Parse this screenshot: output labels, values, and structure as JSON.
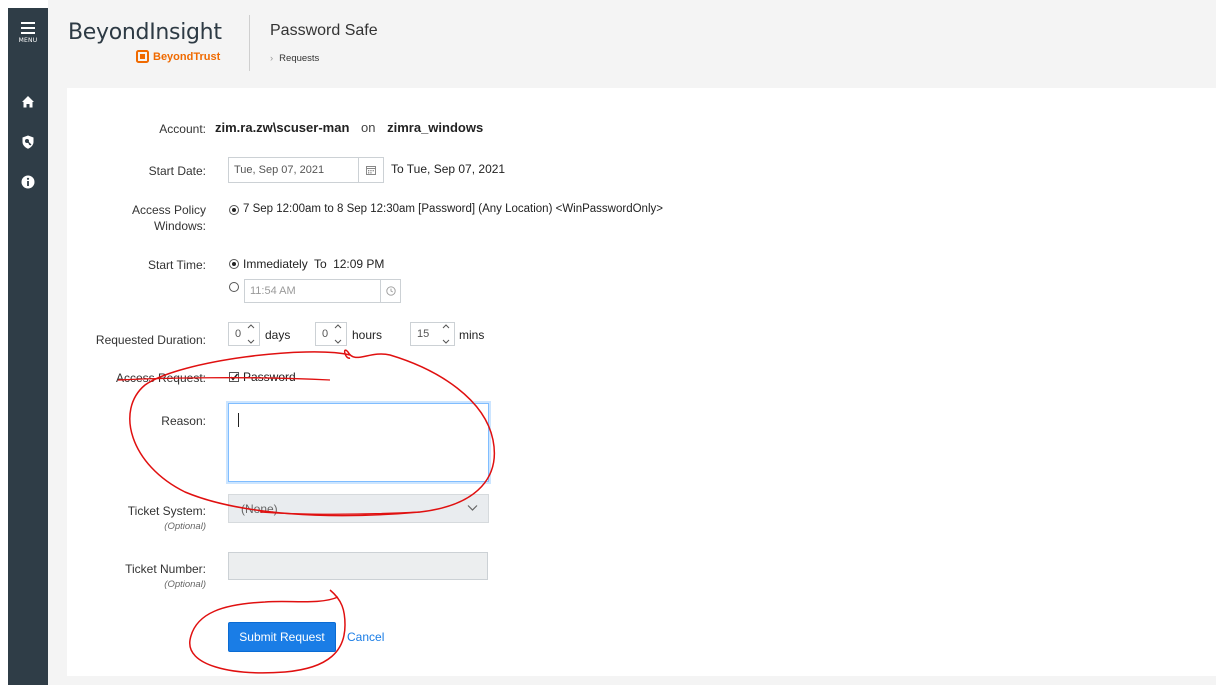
{
  "sidebar": {
    "menu_label": "MENU",
    "icons": [
      "home-icon",
      "key-shield-icon",
      "info-icon"
    ]
  },
  "header": {
    "brand_title": "BeyondInsight",
    "brand_sub": "BeyondTrust",
    "app_title": "Password Safe",
    "breadcrumb": "Requests"
  },
  "form": {
    "account": {
      "label": "Account:",
      "name": "zim.ra.zw\\scuser-man",
      "on": "on",
      "system": "zimra_windows"
    },
    "start_date": {
      "label": "Start Date:",
      "value": "Tue, Sep 07, 2021",
      "to_text": "To Tue, Sep 07, 2021"
    },
    "access_policy": {
      "label_line1": "Access Policy",
      "label_line2": "Windows:",
      "option": "7 Sep 12:00am to 8 Sep 12:30am [Password] (Any Location) <WinPasswordOnly>"
    },
    "start_time": {
      "label": "Start Time:",
      "immediately": "Immediately",
      "to": "To",
      "end_time": "12:09 PM",
      "time_value": "11:54 AM"
    },
    "duration": {
      "label": "Requested Duration:",
      "days": "0",
      "days_unit": "days",
      "hours": "0",
      "hours_unit": "hours",
      "mins": "15",
      "mins_unit": "mins"
    },
    "access_request": {
      "label": "Access Request:",
      "option": "Password"
    },
    "reason": {
      "label": "Reason:",
      "value": ""
    },
    "ticket_system": {
      "label": "Ticket System:",
      "optional": "(Optional)",
      "value": "(None)"
    },
    "ticket_number": {
      "label": "Ticket Number:",
      "optional": "(Optional)",
      "value": ""
    },
    "submit_label": "Submit Request",
    "cancel_label": "Cancel"
  },
  "colors": {
    "sidebar": "#2f3d47",
    "accent": "#1a7de6",
    "brand_orange": "#f06a00",
    "annotation": "#e01010"
  }
}
